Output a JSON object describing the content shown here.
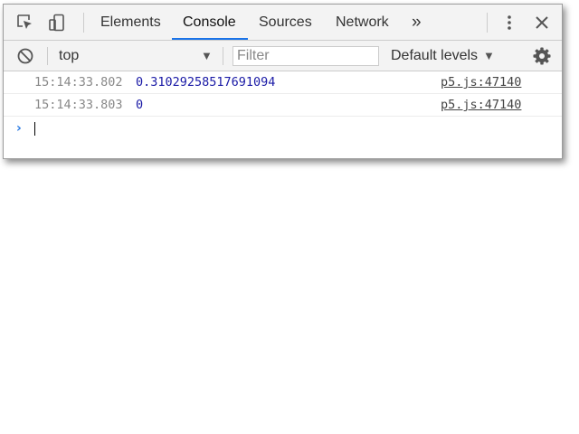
{
  "tabbar": {
    "icons": {
      "inspect": "inspect-element-icon",
      "device": "device-toolbar-icon",
      "more_tabs": "double-chevron-icon",
      "menu": "vertical-dots-icon",
      "close": "close-icon"
    },
    "tabs": [
      "Elements",
      "Console",
      "Sources",
      "Network"
    ],
    "active_tab": "Console",
    "more_tabs_glyph": "»"
  },
  "toolbar": {
    "clear_icon": "block-icon",
    "context": "top",
    "filter_placeholder": "Filter",
    "levels_label": "Default levels",
    "settings_icon": "gear-icon"
  },
  "console": {
    "messages": [
      {
        "timestamp": "15:14:33.802",
        "value": "0.31029258517691094",
        "source": "p5.js:47140"
      },
      {
        "timestamp": "15:14:33.803",
        "value": "0",
        "source": "p5.js:47140"
      }
    ],
    "prompt_glyph": "›"
  },
  "colors": {
    "accent": "#1a73e8",
    "number": "#1a1aa6",
    "timestamp": "#888888",
    "prompt": "#2b7be3"
  }
}
